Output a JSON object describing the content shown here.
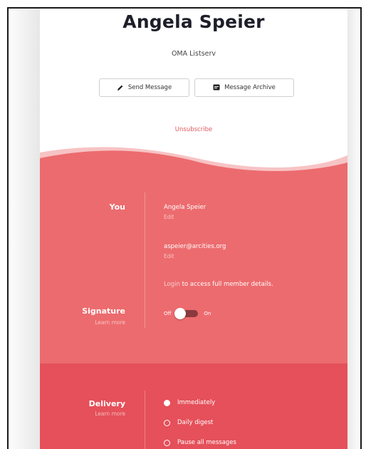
{
  "profile": {
    "name": "Angela Speier",
    "list_name": "OMA Listserv"
  },
  "actions": {
    "send_message": "Send Message",
    "message_archive": "Message Archive",
    "unsubscribe": "Unsubscribe"
  },
  "you_section": {
    "label": "You",
    "display_name": "Angela Speier",
    "name_edit": "Edit",
    "email": "aspeier@arcities.org",
    "email_edit": "Edit",
    "login_link": "Login",
    "login_text": " to access full member details."
  },
  "signature_section": {
    "label": "Signature",
    "learn_more": "Learn more",
    "toggle_off": "Off",
    "toggle_on": "On",
    "enabled": false
  },
  "delivery_section": {
    "label": "Delivery",
    "learn_more": "Learn more",
    "options": [
      {
        "label": "Immediately",
        "selected": true
      },
      {
        "label": "Daily digest",
        "selected": false
      },
      {
        "label": "Pause all messages",
        "selected": false
      }
    ]
  },
  "colors": {
    "accent_pink": "#ec6b6e",
    "accent_red": "#e5505a",
    "unsubscribe": "#e05a5f"
  },
  "icons": {
    "send": "pencil-icon",
    "archive": "archive-icon"
  }
}
